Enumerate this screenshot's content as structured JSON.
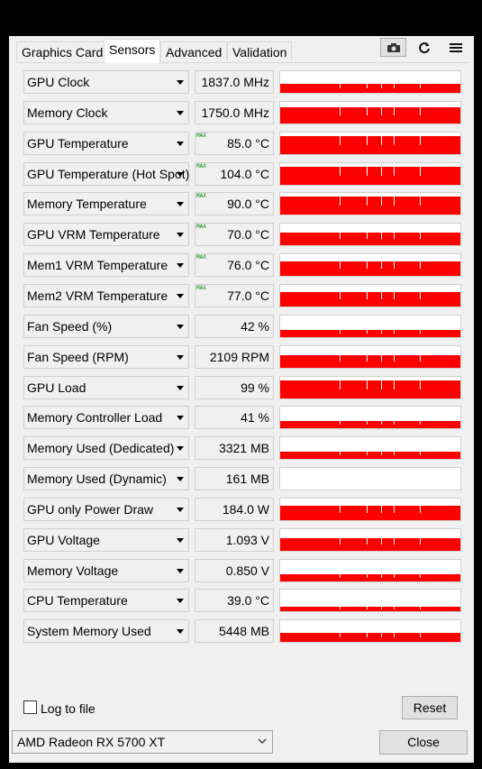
{
  "tabs": [
    "Graphics Card",
    "Sensors",
    "Advanced",
    "Validation"
  ],
  "active_tab": "Sensors",
  "toolbar": {
    "camera_icon": "camera-icon",
    "refresh_icon": "refresh-icon",
    "menu_icon": "hamburger-menu-icon"
  },
  "max_marker": "MAX",
  "graph_color": "#ff0000",
  "sensors": [
    {
      "label": "GPU Clock",
      "value": "1837.0 MHz",
      "max": false,
      "level": 0.42
    },
    {
      "label": "Memory Clock",
      "value": "1750.0 MHz",
      "max": false,
      "level": 0.75
    },
    {
      "label": "GPU Temperature",
      "value": "85.0 °C",
      "max": true,
      "level": 0.82
    },
    {
      "label": "GPU Temperature (Hot Spot)",
      "value": "104.0 °C",
      "max": true,
      "level": 0.82
    },
    {
      "label": "Memory Temperature",
      "value": "90.0 °C",
      "max": true,
      "level": 0.82
    },
    {
      "label": "GPU VRM Temperature",
      "value": "70.0 °C",
      "max": true,
      "level": 0.58
    },
    {
      "label": "Mem1 VRM Temperature",
      "value": "76.0 °C",
      "max": true,
      "level": 0.66
    },
    {
      "label": "Mem2 VRM Temperature",
      "value": "77.0 °C",
      "max": true,
      "level": 0.66
    },
    {
      "label": "Fan Speed (%)",
      "value": "42 %",
      "max": false,
      "level": 0.35
    },
    {
      "label": "Fan Speed (RPM)",
      "value": "2109 RPM",
      "max": false,
      "level": 0.58
    },
    {
      "label": "GPU Load",
      "value": "99 %",
      "max": false,
      "level": 0.82
    },
    {
      "label": "Memory Controller Load",
      "value": "41 %",
      "max": false,
      "level": 0.35
    },
    {
      "label": "Memory Used (Dedicated)",
      "value": "3321 MB",
      "max": false,
      "level": 0.35
    },
    {
      "label": "Memory Used (Dynamic)",
      "value": "161 MB",
      "max": false,
      "level": 0.0
    },
    {
      "label": "GPU only Power Draw",
      "value": "184.0 W",
      "max": false,
      "level": 0.66
    },
    {
      "label": "GPU Voltage",
      "value": "1.093 V",
      "max": false,
      "level": 0.58
    },
    {
      "label": "Memory Voltage",
      "value": "0.850 V",
      "max": false,
      "level": 0.35
    },
    {
      "label": "CPU Temperature",
      "value": "39.0 °C",
      "max": false,
      "level": 0.2
    },
    {
      "label": "System Memory Used",
      "value": "5448 MB",
      "max": false,
      "level": 0.42
    }
  ],
  "log_to_file": {
    "label": "Log to file",
    "checked": false
  },
  "reset_label": "Reset",
  "gpu_select": {
    "value": "AMD Radeon RX 5700 XT"
  },
  "close_label": "Close"
}
